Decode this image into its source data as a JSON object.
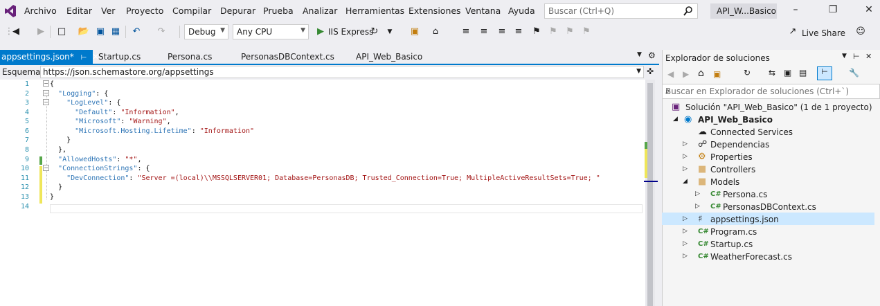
{
  "menu": {
    "items": [
      "Archivo",
      "Editar",
      "Ver",
      "Proyecto",
      "Compilar",
      "Depurar",
      "Prueba",
      "Analizar",
      "Herramientas",
      "Extensiones",
      "Ventana",
      "Ayuda"
    ],
    "search_placeholder": "Buscar (Ctrl+Q)",
    "project_badge": "API_W...Basico"
  },
  "toolbar": {
    "config": "Debug",
    "platform": "Any CPU",
    "run_label": "IIS Express",
    "live_share": "Live Share"
  },
  "tabs": [
    {
      "label": "appsettings.json*",
      "active": true
    },
    {
      "label": "Startup.cs"
    },
    {
      "label": "Persona.cs"
    },
    {
      "label": "PersonasDBContext.cs"
    },
    {
      "label": "API_Web_Basico"
    }
  ],
  "schema": {
    "label": "Esquema:",
    "url": "https://json.schemastore.org/appsettings"
  },
  "editor": {
    "line_numbers": [
      "1",
      "2",
      "3",
      "4",
      "5",
      "6",
      "7",
      "8",
      "9",
      "10",
      "11",
      "12",
      "13",
      "14"
    ],
    "lines": [
      "{",
      "  \"Logging\": {",
      "    \"LogLevel\": {",
      "      \"Default\": \"Information\",",
      "      \"Microsoft\": \"Warning\",",
      "      \"Microsoft.Hosting.Lifetime\": \"Information\"",
      "    }",
      "  },",
      "  \"AllowedHosts\": \"*\",",
      "  \"ConnectionStrings\": {",
      "    \"DevConnection\": \"Server =(local)\\\\MSSQLSERVER01; Database=PersonasDB; Trusted_Connection=True; MultipleActiveResultSets=True; \"",
      "  }",
      "}",
      ""
    ]
  },
  "solution_explorer": {
    "title": "Explorador de soluciones",
    "search_placeholder": "Buscar en Explorador de soluciones (Ctrl+`)",
    "items": [
      {
        "label": "Solución \"API_Web_Basico\" (1 de 1 proyecto)"
      },
      {
        "label": "API_Web_Basico"
      },
      {
        "label": "Connected Services"
      },
      {
        "label": "Dependencias"
      },
      {
        "label": "Properties"
      },
      {
        "label": "Controllers"
      },
      {
        "label": "Models"
      },
      {
        "label": "Persona.cs"
      },
      {
        "label": "PersonasDBContext.cs"
      },
      {
        "label": "appsettings.json",
        "selected": true
      },
      {
        "label": "Program.cs"
      },
      {
        "label": "Startup.cs"
      },
      {
        "label": "WeatherForecast.cs"
      }
    ]
  },
  "colors": {
    "accent": "#007acc",
    "json_key": "#2e75b6",
    "json_string": "#a31515",
    "line_number": "#2b91af"
  }
}
